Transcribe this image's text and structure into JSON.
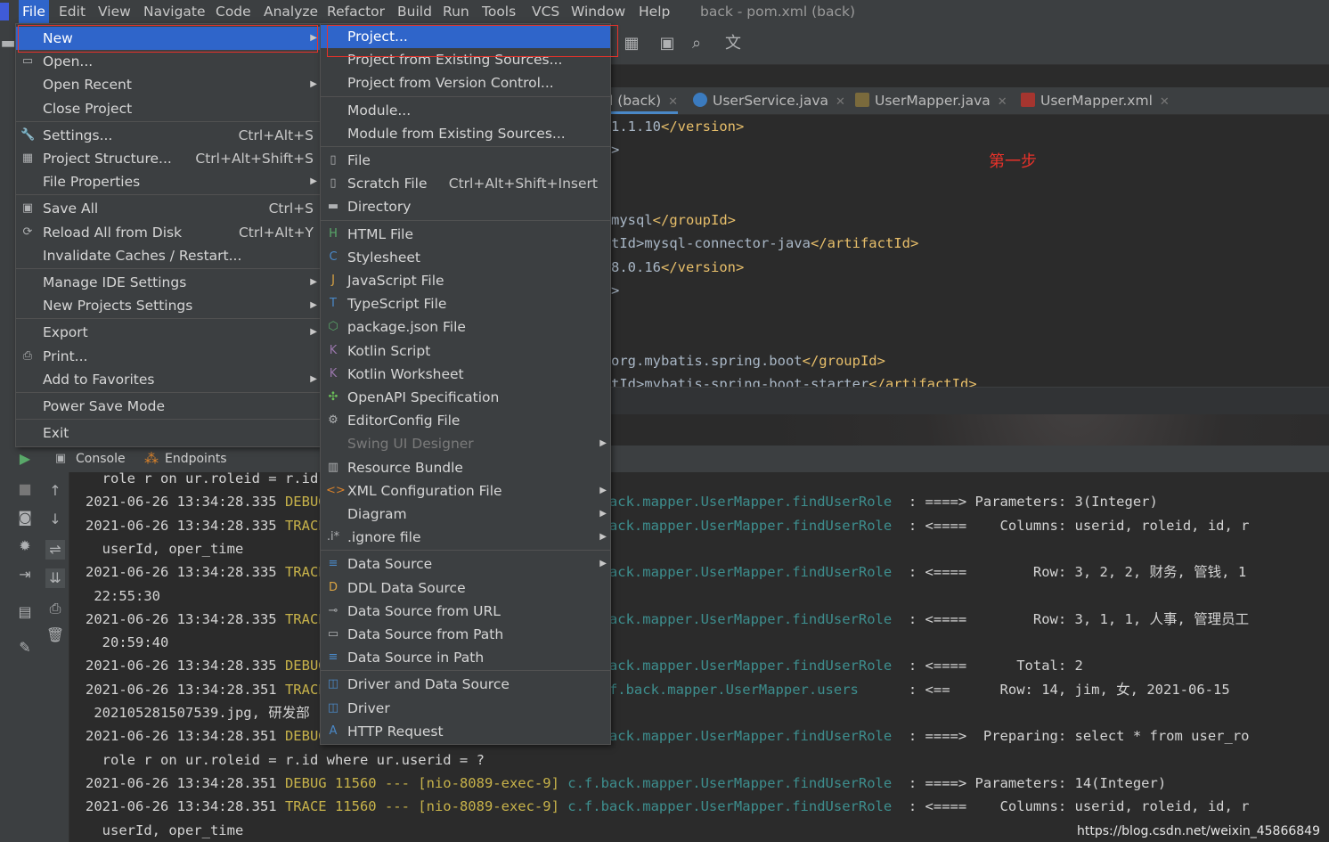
{
  "menubar": {
    "items": [
      "File",
      "Edit",
      "View",
      "Navigate",
      "Code",
      "Analyze",
      "Refactor",
      "Build",
      "Run",
      "Tools",
      "VCS",
      "Window",
      "Help"
    ],
    "title": "back - pom.xml (back)"
  },
  "editor_tabs": [
    {
      "label": "l (back)",
      "active": true
    },
    {
      "label": "UserService.java",
      "active": false
    },
    {
      "label": "UserMapper.java",
      "active": false
    },
    {
      "label": "UserMapper.xml",
      "active": false
    }
  ],
  "editor_lines": [
    {
      "pre": "1.1.10",
      "tag": "</version>"
    },
    {
      "pre": ">",
      "tag": ""
    },
    {
      "pre": "",
      "tag": ""
    },
    {
      "pre": "",
      "tag": ""
    },
    {
      "pre": "mysql",
      "tag": "</groupId>"
    },
    {
      "pre": "tId>mysql-connector-java",
      "tag": "</artifactId>"
    },
    {
      "pre": "8.0.16",
      "tag": "</version>"
    },
    {
      "pre": ">",
      "tag": ""
    },
    {
      "pre": "",
      "tag": ""
    },
    {
      "pre": "",
      "tag": ""
    },
    {
      "pre": "org.mybatis.spring.boot",
      "tag": "</groupId>"
    },
    {
      "pre": "tId>mybatis-spring-boot-starter",
      "tag": "</artifactId>"
    }
  ],
  "annotation_note": "第一步",
  "run_tabs": {
    "console": "Console",
    "endpoints": "Endpoints"
  },
  "console_lines": [
    {
      "text": "  role r on ur.roleid = r.id where ur.userid = ?",
      "level": "",
      "cls": "",
      "rest": ""
    },
    {
      "text": "2021-06-26 13:34:28.335 ",
      "level": "DEBUG",
      "mid": " 11560 --- [nio-8089-exec-9] ",
      "cls": "c.f.back.mapper.UserMapper.findUserRole",
      "rest": "  : ====> Parameters: 3(Integer)"
    },
    {
      "text": "2021-06-26 13:34:28.335 ",
      "level": "TRACE",
      "mid": " 11560 --- [nio-8089-exec-9] ",
      "cls": "c.f.back.mapper.UserMapper.findUserRole",
      "rest": "  : <====    Columns: userid, roleid, id, r"
    },
    {
      "text": "  userId, oper_time",
      "level": "",
      "cls": "",
      "rest": ""
    },
    {
      "text": "2021-06-26 13:34:28.335 ",
      "level": "TRACE",
      "mid": " 11560 --- [nio-8089-exec-9] ",
      "cls": "c.f.back.mapper.UserMapper.findUserRole",
      "rest": "  : <====        Row: 3, 2, 2, 财务, 管钱, 1"
    },
    {
      "text": " 22:55:30",
      "level": "",
      "cls": "",
      "rest": ""
    },
    {
      "text": "2021-06-26 13:34:28.335 ",
      "level": "TRACE",
      "mid": " 11560 --- [nio-8089-exec-9] ",
      "cls": "c.f.back.mapper.UserMapper.findUserRole",
      "rest": "  : <====        Row: 3, 1, 1, 人事, 管理员工"
    },
    {
      "text": "  20:59:40",
      "level": "",
      "cls": "",
      "rest": ""
    },
    {
      "text": "2021-06-26 13:34:28.335 ",
      "level": "DEBUG",
      "mid": " 11560 --- [nio-8089-exec-9] ",
      "cls": "c.f.back.mapper.UserMapper.findUserRole",
      "rest": "  : <====      Total: 2"
    },
    {
      "text": "2021-06-26 13:34:28.351 ",
      "level": "TRACE",
      "mid": " 11560 --- [nio-8089-exec-9] ",
      "cls": "com.ff.back.mapper.UserMapper.users",
      "rest": "      : <==      Row: 14, jim, 女, 2021-06-15"
    },
    {
      "text": " 202105281507539.jpg, 研发部",
      "level": "",
      "cls": "",
      "rest": ""
    },
    {
      "text": "2021-06-26 13:34:28.351 ",
      "level": "DEBUG",
      "mid": " 11560 --- [nio-8089-exec-9] ",
      "cls": "c.f.back.mapper.UserMapper.findUserRole",
      "rest": "  : ====>  Preparing: select * from user_ro"
    },
    {
      "text": "  role r on ur.roleid = r.id where ur.userid = ?",
      "level": "",
      "cls": "",
      "rest": ""
    },
    {
      "text": "2021-06-26 13:34:28.351 ",
      "level": "DEBUG",
      "mid": " 11560 --- [nio-8089-exec-9] ",
      "cls": "c.f.back.mapper.UserMapper.findUserRole",
      "rest": "  : ====> Parameters: 14(Integer)"
    },
    {
      "text": "2021-06-26 13:34:28.351 ",
      "level": "TRACE",
      "mid": " 11560 --- [nio-8089-exec-9] ",
      "cls": "c.f.back.mapper.UserMapper.findUserRole",
      "rest": "  : <====    Columns: userid, roleid, id, r"
    },
    {
      "text": "  userId, oper_time",
      "level": "",
      "cls": "",
      "rest": ""
    }
  ],
  "watermark": "https://blog.csdn.net/weixin_45866849",
  "file_menu": [
    {
      "label": "New",
      "arrow": true,
      "selected": true,
      "icon": ""
    },
    {
      "label": "Open...",
      "icon": "folder-open-icon"
    },
    {
      "label": "Open Recent",
      "arrow": true
    },
    {
      "label": "Close Project"
    },
    {
      "sep": true
    },
    {
      "label": "Settings...",
      "shortcut": "Ctrl+Alt+S",
      "icon": "wrench-icon"
    },
    {
      "label": "Project Structure...",
      "shortcut": "Ctrl+Alt+Shift+S",
      "icon": "project-structure-icon"
    },
    {
      "label": "File Properties",
      "arrow": true
    },
    {
      "sep": true
    },
    {
      "label": "Save All",
      "shortcut": "Ctrl+S",
      "icon": "save-icon"
    },
    {
      "label": "Reload All from Disk",
      "shortcut": "Ctrl+Alt+Y",
      "icon": "reload-icon"
    },
    {
      "label": "Invalidate Caches / Restart..."
    },
    {
      "sep": true
    },
    {
      "label": "Manage IDE Settings",
      "arrow": true
    },
    {
      "label": "New Projects Settings",
      "arrow": true
    },
    {
      "sep": true
    },
    {
      "label": "Export",
      "arrow": true
    },
    {
      "label": "Print...",
      "icon": "print-icon"
    },
    {
      "label": "Add to Favorites",
      "arrow": true
    },
    {
      "sep": true
    },
    {
      "label": "Power Save Mode"
    },
    {
      "sep": true
    },
    {
      "label": "Exit"
    }
  ],
  "new_menu": [
    {
      "label": "Project...",
      "selected": true
    },
    {
      "label": "Project from Existing Sources..."
    },
    {
      "label": "Project from Version Control..."
    },
    {
      "sep": true
    },
    {
      "label": "Module..."
    },
    {
      "label": "Module from Existing Sources..."
    },
    {
      "sep": true
    },
    {
      "label": "File",
      "icon": "file-icon"
    },
    {
      "label": "Scratch File",
      "shortcut": "Ctrl+Alt+Shift+Insert",
      "icon": "scratch-file-icon"
    },
    {
      "label": "Directory",
      "icon": "folder-icon"
    },
    {
      "sep": true
    },
    {
      "label": "HTML File",
      "icon": "html-file-icon"
    },
    {
      "label": "Stylesheet",
      "icon": "css-file-icon"
    },
    {
      "label": "JavaScript File",
      "icon": "js-file-icon"
    },
    {
      "label": "TypeScript File",
      "icon": "ts-file-icon"
    },
    {
      "label": "package.json File",
      "icon": "nodejs-icon"
    },
    {
      "label": "Kotlin Script",
      "icon": "kotlin-script-icon"
    },
    {
      "label": "Kotlin Worksheet",
      "icon": "kotlin-worksheet-icon"
    },
    {
      "label": "OpenAPI Specification",
      "icon": "openapi-icon"
    },
    {
      "label": "EditorConfig File",
      "icon": "gear-icon"
    },
    {
      "label": "Swing UI Designer",
      "arrow": true,
      "disabled": true
    },
    {
      "label": "Resource Bundle",
      "icon": "resource-bundle-icon"
    },
    {
      "label": "XML Configuration File",
      "arrow": true,
      "icon": "xml-file-icon"
    },
    {
      "label": "Diagram",
      "arrow": true
    },
    {
      "label": ".ignore file",
      "arrow": true,
      "icon": "ignore-file-icon"
    },
    {
      "sep": true
    },
    {
      "label": "Data Source",
      "arrow": true,
      "icon": "database-icon"
    },
    {
      "label": "DDL Data Source",
      "icon": "ddl-icon"
    },
    {
      "label": "Data Source from URL",
      "icon": "plug-icon"
    },
    {
      "label": "Data Source from Path",
      "icon": "folder-open-icon"
    },
    {
      "label": "Data Source in Path",
      "icon": "database-icon"
    },
    {
      "sep": true
    },
    {
      "label": "Driver and Data Source",
      "icon": "driver-datasource-icon"
    },
    {
      "label": "Driver",
      "icon": "driver-icon"
    },
    {
      "label": "HTTP Request",
      "icon": "api-icon"
    }
  ],
  "colors": {
    "accent": "#2f65ca",
    "highlight_box": "#e8322a",
    "menu_bg": "#3c3f41"
  }
}
